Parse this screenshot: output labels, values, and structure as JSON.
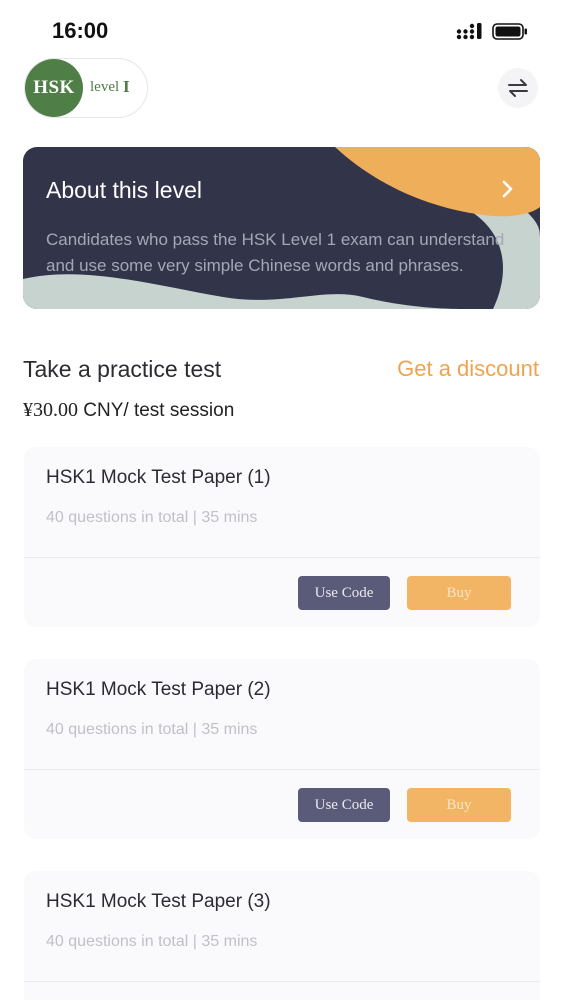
{
  "status": {
    "time": "16:00"
  },
  "level": {
    "badge": "HSK",
    "label": "level",
    "number": "I"
  },
  "about": {
    "title": "About this level",
    "description": "Candidates who pass the HSK Level 1 exam can understand and use some very simple Chinese words and phrases."
  },
  "practice": {
    "title": "Take a practice test",
    "discount_label": "Get a discount",
    "price_amount": "¥30.00",
    "price_unit": " CNY/ test session"
  },
  "tests": [
    {
      "title": "HSK1 Mock Test Paper (1)",
      "meta": "40 questions in total | 35 mins",
      "code_label": "Use Code",
      "buy_label": "Buy"
    },
    {
      "title": "HSK1 Mock Test Paper (2)",
      "meta": "40 questions in total | 35 mins",
      "code_label": "Use Code",
      "buy_label": "Buy"
    },
    {
      "title": "HSK1 Mock Test Paper (3)",
      "meta": "40 questions in total | 35 mins"
    }
  ],
  "colors": {
    "brand_green": "#4f7e46",
    "accent_orange": "#eea44f",
    "card_navy": "#32344a"
  },
  "icons": {
    "signal": "signal-icon",
    "battery": "battery-icon",
    "switch": "swap-arrows-icon",
    "chevron": "chevron-right-icon"
  }
}
